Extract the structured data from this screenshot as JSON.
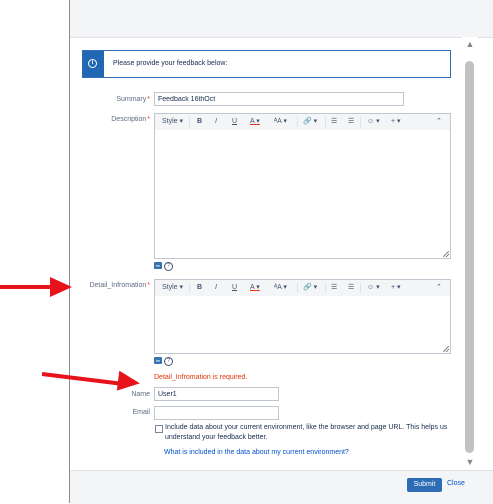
{
  "banner": {
    "message": "Please provide your feedback below:"
  },
  "form": {
    "summary_label": "Summary",
    "summary_value": "Feedback 16thOct",
    "description_label": "Description",
    "detail_label": "Detail_Infromation",
    "required_mark": "*",
    "detail_error": "Detail_Infromation is required.",
    "name_label": "Name",
    "name_value": "User1",
    "email_label": "Email",
    "email_value": "",
    "include_env_text": "Include data about your current environment, like the browser and page URL. This helps us understand your feedback better.",
    "env_link": "What is included in the data about my current environment?"
  },
  "toolbar": {
    "style": "Style",
    "bold": "B",
    "italic": "I",
    "underline": "U",
    "color": "A",
    "more_format": "ᴬA",
    "link": "🔗",
    "bullet_list": "☰",
    "number_list": "☰",
    "emoji": "☺",
    "insert": "+",
    "caret": "▾",
    "collapse": "⌃"
  },
  "footer": {
    "submit": "Submit",
    "close": "Close"
  },
  "mini_icons": {
    "wiki": "tm",
    "help": "?"
  },
  "colors": {
    "accent": "#2e6cb5",
    "error": "#de350b",
    "arrow": "#e8121a"
  }
}
